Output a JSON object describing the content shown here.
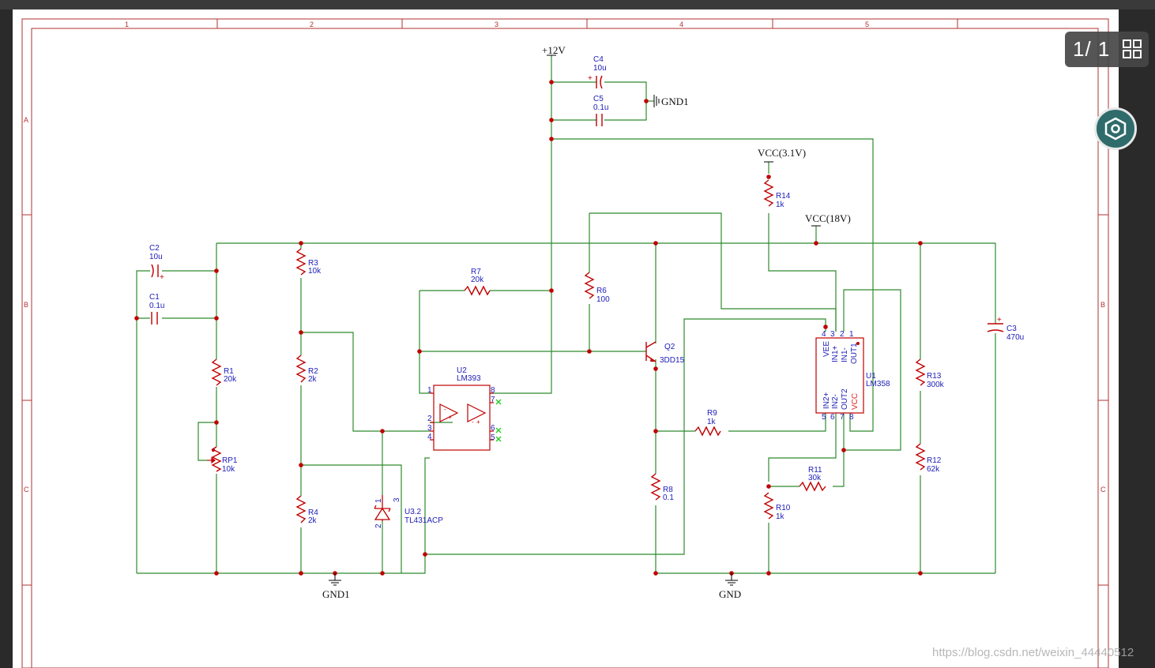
{
  "viewer": {
    "page_indicator": "1/ 1",
    "grid_icon": "grid-view-icon",
    "nav_icon": "hexagon-nav-icon",
    "watermark": "https://blog.csdn.net/weixin_44440512"
  },
  "frame": {
    "columns": [
      "1",
      "2",
      "3",
      "4",
      "5"
    ],
    "rows": [
      "A",
      "B",
      "C"
    ]
  },
  "power": {
    "p12v": "+12V",
    "gnd1_top": "GND1",
    "vcc31": "VCC(3.1V)",
    "vcc18": "VCC(18V)",
    "gnd1_bottom": "GND1",
    "gnd": "GND"
  },
  "components": {
    "C4": {
      "ref": "C4",
      "val": "10u"
    },
    "C5": {
      "ref": "C5",
      "val": "0.1u"
    },
    "C2": {
      "ref": "C2",
      "val": "10u"
    },
    "C1": {
      "ref": "C1",
      "val": "0.1u"
    },
    "R3": {
      "ref": "R3",
      "val": "10k"
    },
    "R7": {
      "ref": "R7",
      "val": "20k"
    },
    "R6": {
      "ref": "R6",
      "val": "100"
    },
    "R14": {
      "ref": "R14",
      "val": "1k"
    },
    "R1": {
      "ref": "R1",
      "val": "20k"
    },
    "R2": {
      "ref": "R2",
      "val": "2k"
    },
    "U2": {
      "ref": "U2",
      "val": "LM393"
    },
    "Q2": {
      "ref": "Q2",
      "val": "3DD15"
    },
    "U1": {
      "ref": "U1",
      "val": "LM358"
    },
    "C3": {
      "ref": "C3",
      "val": "470u"
    },
    "R13": {
      "ref": "R13",
      "val": "300k"
    },
    "RP1": {
      "ref": "RP1",
      "val": "10k"
    },
    "R9": {
      "ref": "R9",
      "val": "1k"
    },
    "R11": {
      "ref": "R11",
      "val": "30k"
    },
    "R12": {
      "ref": "R12",
      "val": "62k"
    },
    "R8": {
      "ref": "R8",
      "val": "0.1"
    },
    "R10": {
      "ref": "R10",
      "val": "1k"
    },
    "R4": {
      "ref": "R4",
      "val": "2k"
    },
    "U3": {
      "ref": "U3.2",
      "val": "TL431ACP"
    }
  },
  "pins": {
    "u2": [
      "1",
      "2",
      "3",
      "4",
      "8",
      "7",
      "6",
      "5"
    ],
    "u1_top": [
      "VEE",
      "IN1+",
      "IN1-",
      "OUT1"
    ],
    "u1_top_nums": [
      "4",
      "3",
      "2",
      "1"
    ],
    "u1_bottom": [
      "IN2+",
      "IN2-",
      "OUT2",
      "VCC"
    ],
    "u1_bottom_nums": [
      "5",
      "6",
      "7",
      "8"
    ],
    "u3_nums": [
      "1",
      "2",
      "3"
    ]
  },
  "colors": {
    "wire": "#2e8b2e",
    "part": "#c00000",
    "label": "#1c1cb8",
    "frame": "#b03030",
    "nc": "#22cc22"
  }
}
